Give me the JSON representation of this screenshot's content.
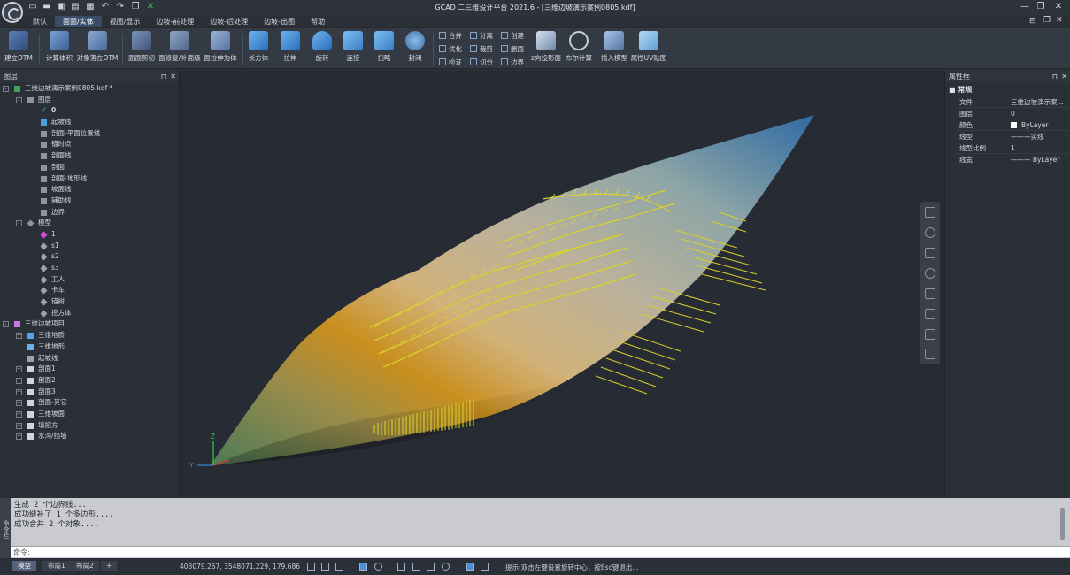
{
  "app": {
    "title": "GCAD 二三维设计平台 2021.6 - [三维边坡演示案例0805.kdf]"
  },
  "quick_access": [
    "new-icon",
    "open-icon",
    "save-icon",
    "saveas-icon",
    "print-icon",
    "undo-icon",
    "redo-icon",
    "copy-icon",
    "excel-icon"
  ],
  "menu_tabs": [
    {
      "label": "默认",
      "active": false
    },
    {
      "label": "面面/实体",
      "active": true
    },
    {
      "label": "视图/显示",
      "active": false
    },
    {
      "label": "边坡-前处理",
      "active": false
    },
    {
      "label": "边坡-后处理",
      "active": false
    },
    {
      "label": "边坡-出图",
      "active": false
    },
    {
      "label": "帮助",
      "active": false
    }
  ],
  "ribbon": {
    "build_dtm": "建立DTM",
    "calc_volume": "计算体积",
    "object_fit_dtm": "对象落在DTM",
    "surface_cut": "面面剪切",
    "surface_fill": "面修复/补面级",
    "surface_extrude": "面拉伸为体",
    "box": "长方体",
    "extrude": "拉伸",
    "revolve": "旋转",
    "loft": "连接",
    "sweep": "扫略",
    "seal": "封闭",
    "merge": "合并",
    "split": "分离",
    "create": "创建",
    "optimize": "优化",
    "trim": "裁剪",
    "delete": "删面",
    "check": "检证",
    "slice": "切分",
    "boundary": "边界",
    "z_projection": "z向投影面",
    "boolean_calc": "布尔计算",
    "insert_model": "插入模型",
    "uv_map": "属性UV贴图"
  },
  "left_panel": {
    "title": "图层",
    "tree": [
      {
        "label": "三维边坡演示案例0805.kdf *",
        "level": 0,
        "expander": "-",
        "icon": "file-icon",
        "icon_color": "#3fa35a"
      },
      {
        "label": "图层",
        "level": 1,
        "expander": "-",
        "icon": "layers-icon",
        "icon_color": "#8a94a2"
      },
      {
        "label": "0",
        "level": 2,
        "expander": "",
        "icon": "check-icon",
        "icon_color": "#3bc16a",
        "bold": true
      },
      {
        "label": "起坡线",
        "level": 2,
        "expander": "",
        "icon": "layer-icon",
        "icon_color": "#4aa0d8"
      },
      {
        "label": "剖面-平面位置线",
        "level": 2,
        "expander": "",
        "icon": "layer-icon",
        "icon_color": "#8a94a2"
      },
      {
        "label": "锚时点",
        "level": 2,
        "expander": "",
        "icon": "layer-icon",
        "icon_color": "#8a94a2"
      },
      {
        "label": "剖面线",
        "level": 2,
        "expander": "",
        "icon": "layer-icon",
        "icon_color": "#8a94a2"
      },
      {
        "label": "剖面",
        "level": 2,
        "expander": "",
        "icon": "layer-icon",
        "icon_color": "#8a94a2"
      },
      {
        "label": "剖面-地形线",
        "level": 2,
        "expander": "",
        "icon": "layer-icon",
        "icon_color": "#8a94a2"
      },
      {
        "label": "坡面线",
        "level": 2,
        "expander": "",
        "icon": "layer-icon",
        "icon_color": "#8a94a2"
      },
      {
        "label": "辅助线",
        "level": 2,
        "expander": "",
        "icon": "layer-icon",
        "icon_color": "#8a94a2"
      },
      {
        "label": "边界",
        "level": 2,
        "expander": "",
        "icon": "layer-icon",
        "icon_color": "#8a94a2"
      },
      {
        "label": "模型",
        "level": 1,
        "expander": "-",
        "icon": "diamond-icon",
        "icon_color": "#8a94a2"
      },
      {
        "label": "1",
        "level": 2,
        "expander": "",
        "icon": "diamond-icon",
        "icon_color": "#d94fd3"
      },
      {
        "label": "s1",
        "level": 2,
        "expander": "",
        "icon": "diamond-icon",
        "icon_color": "#9aa3af"
      },
      {
        "label": "s2",
        "level": 2,
        "expander": "",
        "icon": "diamond-icon",
        "icon_color": "#9aa3af"
      },
      {
        "label": "s3",
        "level": 2,
        "expander": "",
        "icon": "diamond-icon",
        "icon_color": "#9aa3af"
      },
      {
        "label": "工人",
        "level": 2,
        "expander": "",
        "icon": "diamond-icon",
        "icon_color": "#9aa3af"
      },
      {
        "label": "卡车",
        "level": 2,
        "expander": "",
        "icon": "diamond-icon",
        "icon_color": "#9aa3af"
      },
      {
        "label": "锚树",
        "level": 2,
        "expander": "",
        "icon": "diamond-icon",
        "icon_color": "#9aa3af"
      },
      {
        "label": "挖方体",
        "level": 2,
        "expander": "",
        "icon": "diamond-icon",
        "icon_color": "#9aa3af"
      },
      {
        "label": "三维边坡项目",
        "level": 0,
        "expander": "-",
        "icon": "project-icon",
        "icon_color": "#c978e0"
      },
      {
        "label": "三维地质",
        "level": 1,
        "expander": "+",
        "icon": "geology-icon",
        "icon_color": "#5aa0e0"
      },
      {
        "label": "三维地形",
        "level": 1,
        "expander": "",
        "icon": "terrain-icon",
        "icon_color": "#6bb0e8"
      },
      {
        "label": "起坡线",
        "level": 1,
        "expander": "",
        "icon": "line-icon",
        "icon_color": "#9aa3af"
      },
      {
        "label": "剖面1",
        "level": 1,
        "expander": "+",
        "icon": "section-icon",
        "icon_color": "#cfd4db"
      },
      {
        "label": "剖面2",
        "level": 1,
        "expander": "+",
        "icon": "section-icon",
        "icon_color": "#cfd4db"
      },
      {
        "label": "剖面3",
        "level": 1,
        "expander": "+",
        "icon": "section-icon",
        "icon_color": "#cfd4db"
      },
      {
        "label": "剖面-其它",
        "level": 1,
        "expander": "+",
        "icon": "section-icon",
        "icon_color": "#cfd4db"
      },
      {
        "label": "三维坡面",
        "level": 1,
        "expander": "+",
        "icon": "slope-icon",
        "icon_color": "#cfd4db"
      },
      {
        "label": "填挖方",
        "level": 1,
        "expander": "+",
        "icon": "cutfill-icon",
        "icon_color": "#cfd4db"
      },
      {
        "label": "水沟/挡墙",
        "level": 1,
        "expander": "+",
        "icon": "ditch-icon",
        "icon_color": "#cfd4db"
      }
    ]
  },
  "right_panel": {
    "title": "属性框",
    "section": "常规",
    "properties": [
      {
        "key": "文件",
        "value": "三维边坡演示案..."
      },
      {
        "key": "图层",
        "value": "0"
      },
      {
        "key": "颜色",
        "value": "ByLayer"
      },
      {
        "key": "线型",
        "value": "———实线"
      },
      {
        "key": "线型比例",
        "value": "1"
      },
      {
        "key": "线宽",
        "value": "——— ByLayer"
      }
    ]
  },
  "command": {
    "sidebar_label": "命令栏",
    "log": [
      "生成 2 个边界线...",
      "成功缝补了 1 个多边形....",
      "成功合并 2 个对象...."
    ],
    "prompt": "命令:"
  },
  "statusbar": {
    "tabs": [
      {
        "label": "模型",
        "active": true
      },
      {
        "label": "布局1",
        "active": false
      },
      {
        "label": "布局2",
        "active": false
      },
      {
        "label": "+",
        "active": false
      }
    ],
    "coordinates": "403079.267, 3548071.229, 179.686",
    "hint": "提示(双击左键设置旋转中心，按Esc键退出..."
  },
  "viewport": {
    "axis_z": "Z",
    "axis_y": "Y",
    "axis_x": "X"
  }
}
